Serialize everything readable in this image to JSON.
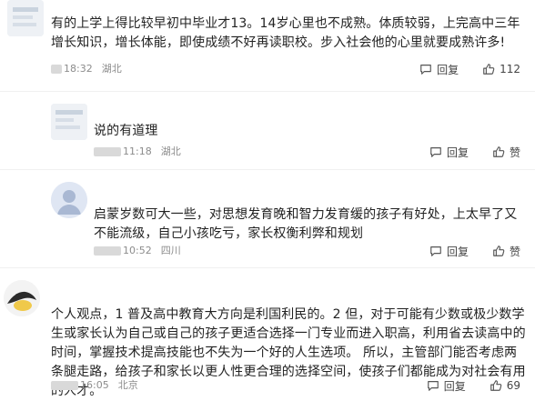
{
  "comments": [
    {
      "text": "有的上学上得比较早初中毕业才13。14岁心里也不成熟。体质较弱，上完高中三年增长知识，增长体能，即使成绩不好再读职校。步入社会他的心里就要成熟许多!",
      "time": "18:32",
      "location": "湖北",
      "reply_label": "回复",
      "like_label": "112"
    },
    {
      "text": "说的有道理",
      "time": "11:18",
      "location": "湖北",
      "reply_label": "回复",
      "like_label": "赞"
    },
    {
      "text": "启蒙岁数可大一些，对思想发育晚和智力发育缓的孩子有好处，上太早了又不能流级，自己小孩吃亏，家长权衡利弊和规划",
      "time": "10:52",
      "location": "四川",
      "reply_label": "回复",
      "like_label": "赞"
    },
    {
      "text": "个人观点，1 普及高中教育大方向是利国利民的。2 但，对于可能有少数或极少数学生或家长认为自己或自己的孩子更适合选择一门专业而进入职高，利用省去读高中的时间，掌握技术提高技能也不失为一个好的人生选项。 所以，主管部门能否考虑两条腿走路，给孩子和家长以更人性更合理的选择空间，使孩子们都能成为对社会有用的人才。",
      "time": "16:05",
      "location": "北京",
      "reply_label": "回复",
      "like_label": "69"
    }
  ],
  "icons": {
    "reply": "comment-bubble-icon",
    "like": "thumbs-up-icon"
  },
  "colors": {
    "meta": "#8c8c8c",
    "text": "#222222"
  }
}
